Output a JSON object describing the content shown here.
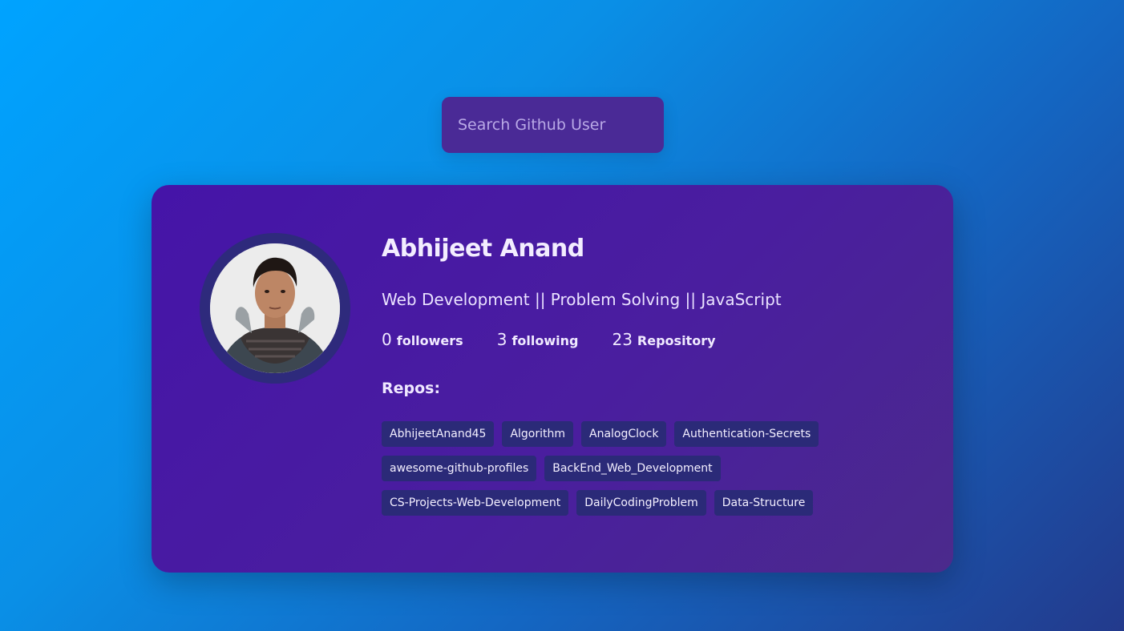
{
  "search": {
    "placeholder": "Search Github User",
    "value": ""
  },
  "profile": {
    "name": "Abhijeet Anand",
    "bio": "Web Development || Problem Solving || JavaScript",
    "stats": {
      "followers_count": "0",
      "followers_label": "followers",
      "following_count": "3",
      "following_label": "following",
      "repos_count": "23",
      "repos_label": "Repository"
    },
    "repos_title": "Repos:",
    "repos": [
      "AbhijeetAnand45",
      "Algorithm",
      "AnalogClock",
      "Authentication-Secrets",
      "awesome-github-profiles",
      "BackEnd_Web_Development",
      "CS-Projects-Web-Development",
      "DailyCodingProblem",
      "Data-Structure"
    ]
  },
  "colors": {
    "background_start": "#00a3ff",
    "background_end": "#233a8c",
    "card": "#4514a8",
    "search_box": "#4a2a96",
    "repo_chip": "#2b2a78",
    "avatar_ring": "#2e2a7c"
  }
}
